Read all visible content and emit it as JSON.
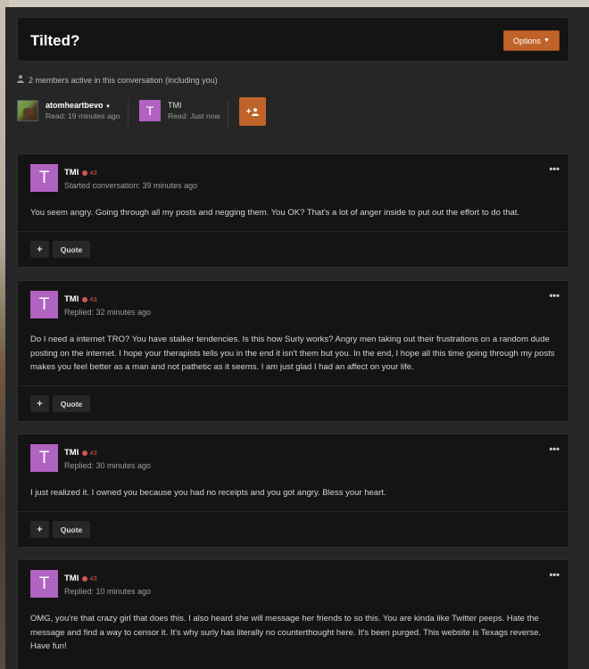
{
  "conversation": {
    "title": "Tilted?",
    "options_label": "Options",
    "members_text": "2 members active in this conversation (including you)"
  },
  "participants": [
    {
      "name": "atomheartbevo",
      "read": "Read: 19 minutes ago",
      "has_dropdown": true
    },
    {
      "name": "TMI",
      "initial": "T",
      "read": "Read: Just now"
    }
  ],
  "invite_label": "+",
  "messages": [
    {
      "author": "TMI",
      "initial": "T",
      "rep": "43",
      "meta": "Started conversation: 39 minutes ago",
      "body": "You seem angry. Going through all my posts and negging them. You OK? That's a lot of anger inside to put out the effort to do that.",
      "plus_label": "+",
      "quote_label": "Quote"
    },
    {
      "author": "TMI",
      "initial": "T",
      "rep": "43",
      "meta": "Replied: 32 minutes ago",
      "body": "Do I need a internet TRO? You have stalker tendencies. Is this how Surly works? Angry men taking out their frustrations on a random dude posting on the internet. I hope your therapists tells you in the end it isn't them but you. In the end, I hope all this time going through my posts makes you feel better as a man and not pathetic as it seems. I am just glad I had an affect on your life.",
      "plus_label": "+",
      "quote_label": "Quote"
    },
    {
      "author": "TMI",
      "initial": "T",
      "rep": "43",
      "meta": "Replied: 30 minutes ago",
      "body": "I just realized it. I owned you because you had no receipts and you got angry. Bless your heart.",
      "plus_label": "+",
      "quote_label": "Quote"
    },
    {
      "author": "TMI",
      "initial": "T",
      "rep": "43",
      "meta": "Replied: 10 minutes ago",
      "body": "OMG, you're that crazy girl that does this. I also heard she will message her friends to so this. You are kinda like Twitter peeps. Hate the message and find a way to censor it. It's why surly has literally no counterthought here. It's been purged. This website is Texags reverse. Have fun!",
      "plus_label": "+",
      "quote_label": "Quote"
    }
  ],
  "icons": {
    "menu": "ellipsis-icon",
    "user": "user-icon",
    "add_user": "add-user-icon"
  },
  "colors": {
    "accent": "#c0632a",
    "avatar": "#b063c0",
    "rep_badge": "#d9534f"
  }
}
